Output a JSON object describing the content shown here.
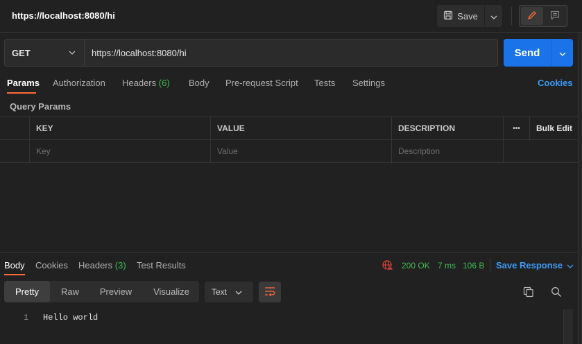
{
  "header": {
    "title": "https://localhost:8080/hi",
    "save_label": "Save"
  },
  "request": {
    "method": "GET",
    "url": "https://localhost:8080/hi",
    "send_label": "Send"
  },
  "request_tabs": {
    "params": "Params",
    "authorization": "Authorization",
    "headers": "Headers",
    "headers_count": "(6)",
    "body": "Body",
    "pre_request": "Pre-request Script",
    "tests": "Tests",
    "settings": "Settings",
    "cookies": "Cookies"
  },
  "query_params": {
    "label": "Query Params",
    "columns": {
      "key": "KEY",
      "value": "VALUE",
      "description": "DESCRIPTION",
      "more": "•••",
      "bulk_edit": "Bulk Edit"
    },
    "placeholders": {
      "key": "Key",
      "value": "Value",
      "description": "Description"
    }
  },
  "response_tabs": {
    "body": "Body",
    "cookies": "Cookies",
    "headers": "Headers",
    "headers_count": "(3)",
    "test_results": "Test Results"
  },
  "response_status": {
    "status": "200 OK",
    "time": "7 ms",
    "size": "106 B",
    "save_response": "Save Response"
  },
  "response_view": {
    "pretty": "Pretty",
    "raw": "Raw",
    "preview": "Preview",
    "visualize": "Visualize",
    "format": "Text"
  },
  "response_body": {
    "lines": [
      {
        "number": "1",
        "text": "Hello world"
      }
    ]
  },
  "colors": {
    "accent_orange": "#ff6c37",
    "send_blue": "#1a73e8",
    "link_blue": "#3d9bf5",
    "success_green": "#3fb950",
    "error_red": "#e5453a"
  },
  "icons": [
    "save-icon",
    "chevron-down-icon",
    "pencil-icon",
    "comment-icon",
    "globe-error-icon",
    "wrap-lines-icon",
    "copy-icon",
    "search-icon"
  ]
}
